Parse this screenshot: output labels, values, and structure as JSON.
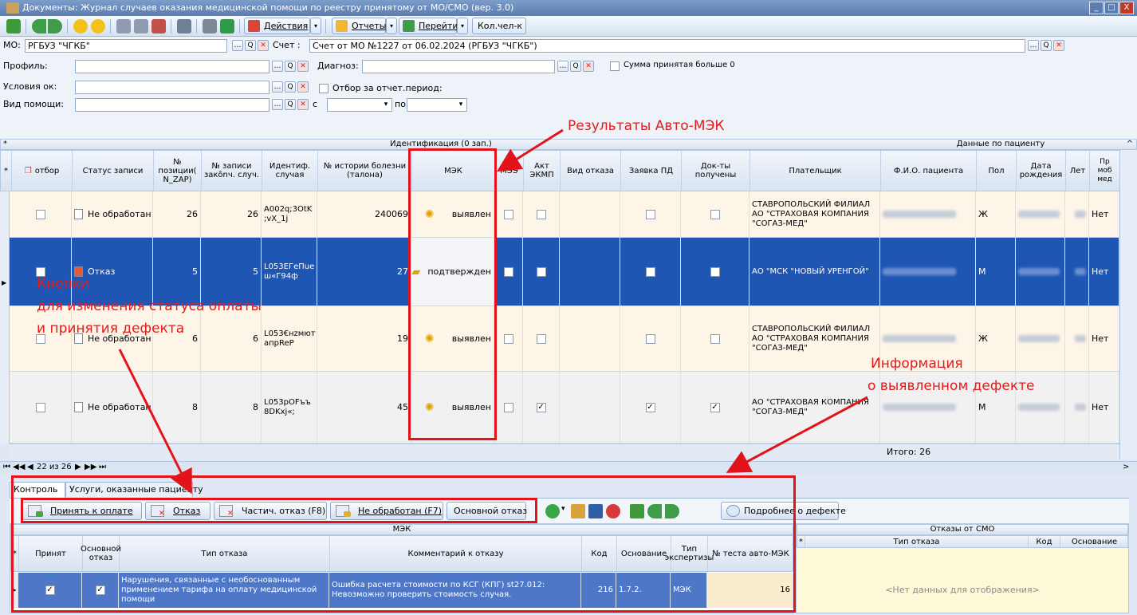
{
  "window": {
    "title": "Документы: Журнал случаев оказания медицинской помощи по реестру принятому от МО/СМО (вер. 3.0)",
    "min": "_",
    "max": "□",
    "close": "X"
  },
  "toolbar": {
    "actions_label": "Действия",
    "reports_label": "Отчеты",
    "goto_label": "Перейти",
    "count_label": "Кол.чел-к"
  },
  "filters": {
    "mo_label": "МО:",
    "mo_value": "РГБУЗ \"ЧГКБ\"",
    "account_label": "Счет :",
    "account_value": "Счет от МО №1227 от 06.02.2024 (РГБУЗ \"ЧГКБ\")",
    "profile_label": "Профиль:",
    "diagnosis_label": "Диагноз:",
    "sum_label": "Сумма принятая больше 0",
    "conditions_label": "Условия ок:",
    "period_label": "Отбор за отчет.период:",
    "help_type_label": "Вид помощи:",
    "from_label": "с",
    "to_label": "по"
  },
  "grid": {
    "group_ident": "Идентификация (0 зап.)",
    "group_patient": "Данные по пациенту",
    "columns": [
      "отбор",
      "Статус записи",
      "№ позиции( N_ZAP)",
      "№ записи закônч. случ.",
      "Идентиф. случая",
      "№ истории болезни (талона)",
      "МЭК",
      "МЭЭ",
      "Акт ЭКМП",
      "Вид отказа",
      "Заявка ПД",
      "Док-ты получены",
      "Плательщик",
      "Ф.И.О. пациента",
      "Пол",
      "Дата рождения",
      "Лет",
      "Пр моб мед"
    ],
    "rows": [
      {
        "status": "Не обработан",
        "pos": "26",
        "rec": "26",
        "ident": "A002q;3OtK\n;vX_1j",
        "history": "240069",
        "mek": "выявлен",
        "akt": false,
        "zayavka": false,
        "docs": false,
        "payer": "СТАВРОПОЛЬСКИЙ ФИЛИАЛ АО \"СТРАХОВАЯ КОМПАНИЯ \"СОГАЗ-МЕД\"",
        "sex": "Ж",
        "mob": "Нет"
      },
      {
        "status": "Отказ",
        "pos": "5",
        "rec": "5",
        "ident": "L053ЕГеПue\nш«Г94ф",
        "history": "27",
        "mek": "подтвержден",
        "akt": false,
        "zayavka": false,
        "docs": false,
        "payer": "АО \"МСК \"НОВЫЙ УРЕНГОЙ\"",
        "sex": "М",
        "mob": "Нет"
      },
      {
        "status": "Не обработан",
        "pos": "6",
        "rec": "6",
        "ident": "L053€нzмют\nапрReP",
        "history": "19",
        "mek": "выявлен",
        "akt": false,
        "zayavka": false,
        "docs": false,
        "payer": "СТАВРОПОЛЬСКИЙ ФИЛИАЛ АО \"СТРАХОВАЯ КОМПАНИЯ \"СОГАЗ-МЕД\"",
        "sex": "Ж",
        "mob": "Нет"
      },
      {
        "status": "Не обработан",
        "pos": "8",
        "rec": "8",
        "ident": "L053рОFъъ\n8DKxj«;",
        "history": "45",
        "mek": "выявлен",
        "akt": true,
        "zayavka": true,
        "docs": true,
        "payer": "АО \"СТРАХОВАЯ КОМПАНИЯ \"СОГАЗ-МЕД\"",
        "sex": "М",
        "mob": "Нет"
      }
    ],
    "total": "Итого: 26",
    "nav_text": "22 из 26"
  },
  "annotations": {
    "auto_mek": "Результаты Авто-МЭК",
    "buttons_line1": "Кнопки",
    "buttons_line2": "для изменения статуса оплаты",
    "buttons_line3": "и принятия дефекта",
    "info_line1": "Информация",
    "info_line2": "о выявленном дефекте"
  },
  "tabs": [
    "Контроль",
    "Услуги, оказанные пациенту"
  ],
  "actions": {
    "accept": "Принять к оплате",
    "refuse": "Отказ",
    "partial": "Частич. отказ (F8)",
    "not_processed": "Не обработан (F7)",
    "main_refuse": "Основной отказ",
    "more_defect": "Подробнее о дефекте"
  },
  "mek_table": {
    "group": "МЭК",
    "columns": [
      "Принят",
      "Основной отказ",
      "Тип отказа",
      "Комментарий к отказу",
      "Код",
      "Основание",
      "Тип экспертизы",
      "№ теста авто-МЭК"
    ],
    "row": {
      "accepted": true,
      "main": true,
      "type": "Нарушения, связанные с необоснованным применением тарифа на оплату медицинской помощи",
      "comment": "Ошибка расчета стоимости по КСГ (КПГ) st27.012: Невозможно проверить стоимость случая.",
      "code": "216",
      "basis": "1.7.2.",
      "expertise": "МЭК",
      "test_no": "16"
    }
  },
  "smo_table": {
    "group": "Отказы от СМО",
    "columns": [
      "Тип отказа",
      "Код",
      "Основание"
    ],
    "empty": "<Нет данных для отображения>"
  },
  "colors": {
    "accent": "#e3131b",
    "selected_row": "#1f56b4"
  }
}
